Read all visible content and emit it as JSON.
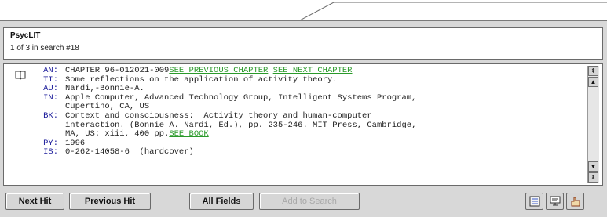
{
  "header": {
    "database_name": "PsycLIT",
    "hit_status": "1 of 3 in search #18"
  },
  "record": {
    "fields": [
      {
        "label": "AN:",
        "lines": [
          {
            "text": "CHAPTER 96-012021-009",
            "links": [
              "SEE PREVIOUS CHAPTER",
              "SEE NEXT CHAPTER"
            ]
          }
        ]
      },
      {
        "label": "TI:",
        "lines": [
          {
            "text": "Some reflections on the application of activity theory."
          }
        ]
      },
      {
        "label": "AU:",
        "lines": [
          {
            "text": "Nardi,-Bonnie-A."
          }
        ]
      },
      {
        "label": "IN:",
        "lines": [
          {
            "text": "Apple Computer, Advanced Technology Group, Intelligent Systems Program,"
          },
          {
            "text": "Cupertino, CA, US"
          }
        ]
      },
      {
        "label": "BK:",
        "lines": [
          {
            "text": "Context and consciousness:  Activity theory and human-computer"
          },
          {
            "text": "interaction. (Bonnie A. Nardi, Ed.), pp. 235-246. MIT Press, Cambridge,"
          },
          {
            "text": "MA, US: xiii, 400 pp.",
            "links": [
              "SEE BOOK"
            ]
          }
        ]
      },
      {
        "label": "PY:",
        "lines": [
          {
            "text": "1996"
          }
        ]
      },
      {
        "label": "IS:",
        "lines": [
          {
            "text": "0-262-14058-6  (hardcover)"
          }
        ]
      }
    ]
  },
  "scrollbar": {
    "top_glyph": "⇞",
    "up_glyph": "▲",
    "down_glyph": "▼",
    "bottom_glyph": "⇟"
  },
  "toolbar": {
    "next_hit": "Next Hit",
    "previous_hit": "Previous Hit",
    "all_fields": "All Fields",
    "add_to_search": "Add to Search"
  },
  "colors": {
    "link": "#2a9a2a",
    "field_label": "#1a1a9a",
    "window_bg": "#d8d8d8"
  }
}
